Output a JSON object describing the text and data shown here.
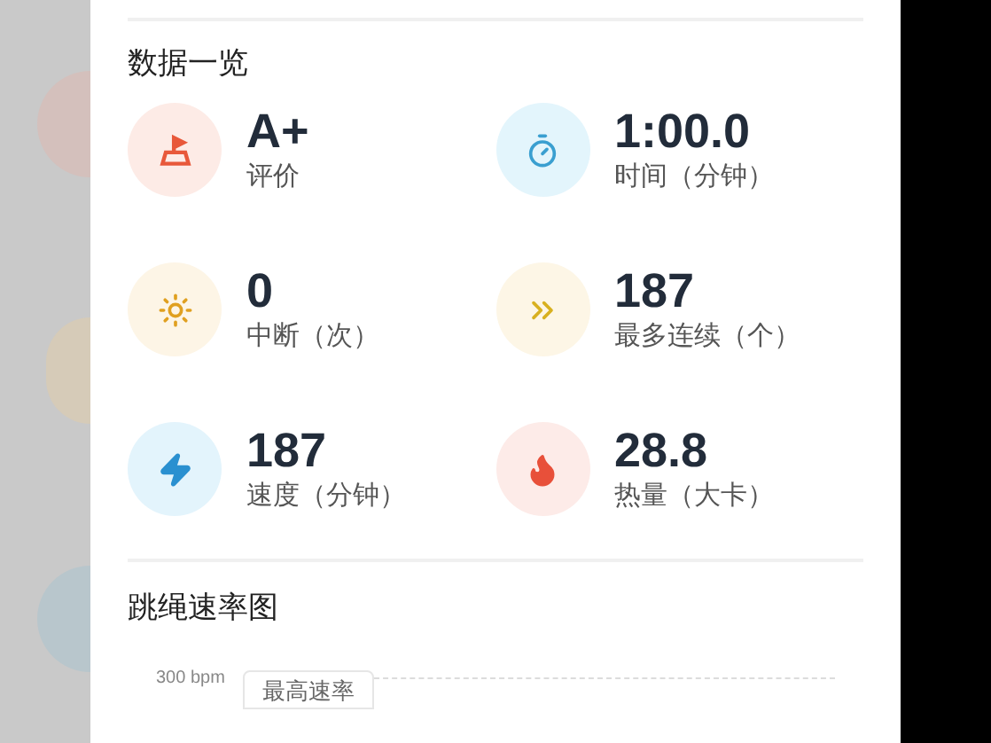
{
  "overview": {
    "title": "数据一览",
    "stats": [
      {
        "kind": "rating",
        "color": "#e8583a",
        "value": "A+",
        "label": "评价"
      },
      {
        "kind": "timer",
        "color": "#3a9fd0",
        "value": "1:00.0",
        "label": "时间（分钟）"
      },
      {
        "kind": "sun",
        "color": "#e0a020",
        "value": "0",
        "label": "中断（次）"
      },
      {
        "kind": "streak",
        "color": "#d8b020",
        "value": "187",
        "label": "最多连续（个）"
      },
      {
        "kind": "bolt",
        "color": "#2a90d0",
        "value": "187",
        "label": "速度（分钟）"
      },
      {
        "kind": "flame",
        "color": "#e8503a",
        "value": "28.8",
        "label": "热量（大卡）"
      }
    ]
  },
  "rate_chart": {
    "title": "跳绳速率图",
    "axis_label": "300 bpm",
    "tooltip": "最高速率"
  }
}
